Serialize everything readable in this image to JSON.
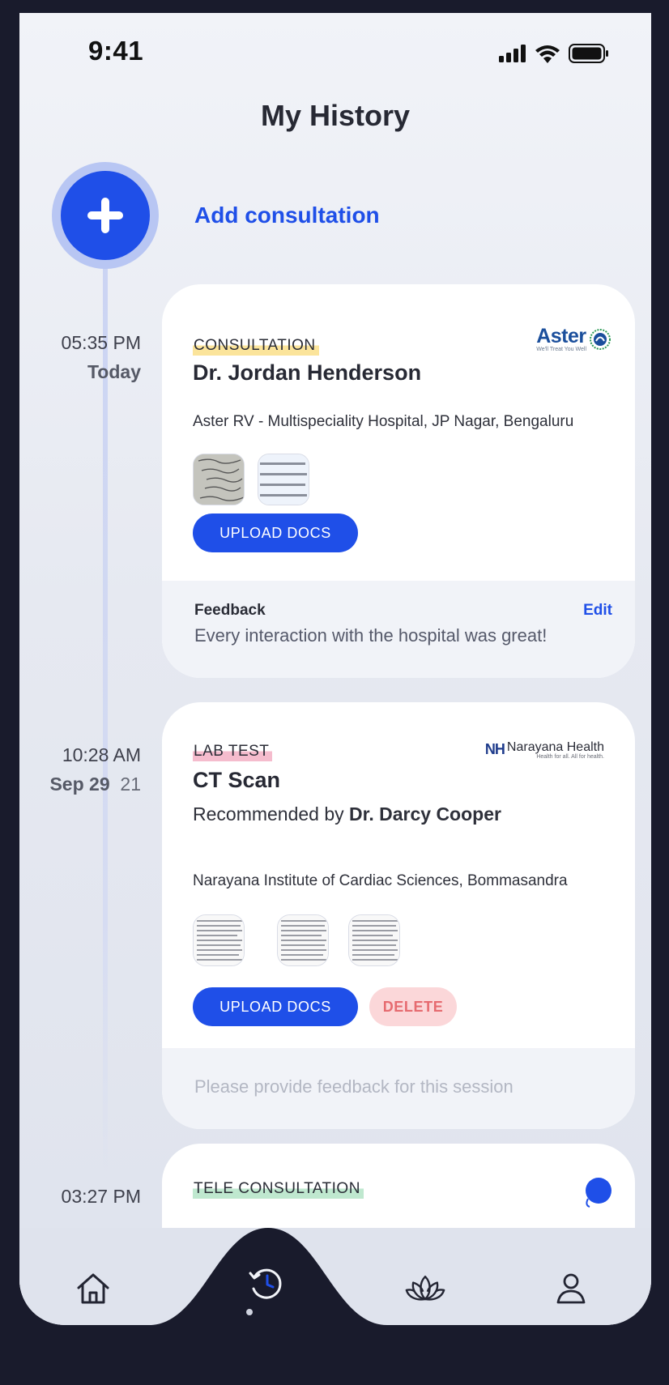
{
  "status_bar": {
    "time": "9:41"
  },
  "header": {
    "title": "My History"
  },
  "add": {
    "label": "Add consultation"
  },
  "entries": [
    {
      "time": "05:35 PM",
      "date_label": "Today",
      "tag": "CONSULTATION",
      "logo": {
        "name": "Aster",
        "tagline": "We'll Treat You Well"
      },
      "doctor": "Dr. Jordan Henderson",
      "hospital": "Aster RV - Multispeciality Hospital, JP Nagar, Bengaluru",
      "upload_label": "UPLOAD DOCS",
      "feedback_label": "Feedback",
      "edit_label": "Edit",
      "feedback_text": "Every interaction with the hospital was great!"
    },
    {
      "time": "10:28 AM",
      "date_bold": "Sep 29",
      "date_year": "21",
      "tag": "LAB TEST",
      "logo": {
        "nh": "NH",
        "name": "Narayana Health",
        "tagline": "Health for all. All for health."
      },
      "test": "CT Scan",
      "recommended_prefix": "Recommended by",
      "recommended_doctor": "Dr. Darcy Cooper",
      "hospital": "Narayana Institute of Cardiac Sciences, Bommasandra",
      "upload_label": "UPLOAD DOCS",
      "delete_label": "DELETE",
      "feedback_placeholder": "Please provide feedback for this session"
    },
    {
      "time": "03:27 PM",
      "tag": "TELE CONSULTATION"
    }
  ],
  "colors": {
    "accent": "#1f4fe8",
    "delete": "#e66b70"
  },
  "nav": [
    "home-icon",
    "history-icon",
    "lotus-icon",
    "profile-icon"
  ]
}
